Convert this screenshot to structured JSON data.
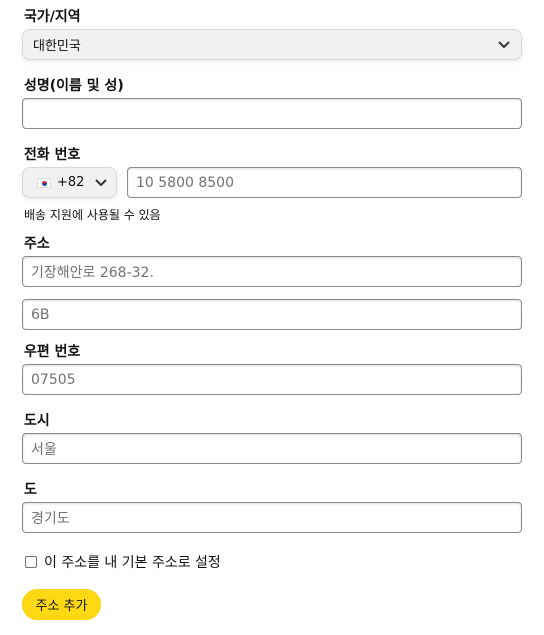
{
  "country": {
    "label": "국가/지역",
    "value": "대한민국"
  },
  "full_name": {
    "label": "성명(이름 및 성)",
    "value": ""
  },
  "phone": {
    "label": "전화 번호",
    "country_code": "+82",
    "flag_icon": "south-korea-flag-icon",
    "placeholder": "10 5800 8500",
    "hint": "배송 지원에 사용될 수 있음"
  },
  "address": {
    "label": "주소",
    "line1_placeholder": "기장해안로 268-32.",
    "line2_placeholder": "6B"
  },
  "postal_code": {
    "label": "우편 번호",
    "placeholder": "07505"
  },
  "city": {
    "label": "도시",
    "placeholder": "서울"
  },
  "province": {
    "label": "도",
    "placeholder": "경기도"
  },
  "default_address": {
    "label": "이 주소를 내 기본 주소로 설정",
    "checked": false
  },
  "submit": {
    "label": "주소 추가"
  },
  "colors": {
    "button": "#ffd814",
    "select_bg": "#f0f2f2",
    "field_border": "#888c8c"
  }
}
